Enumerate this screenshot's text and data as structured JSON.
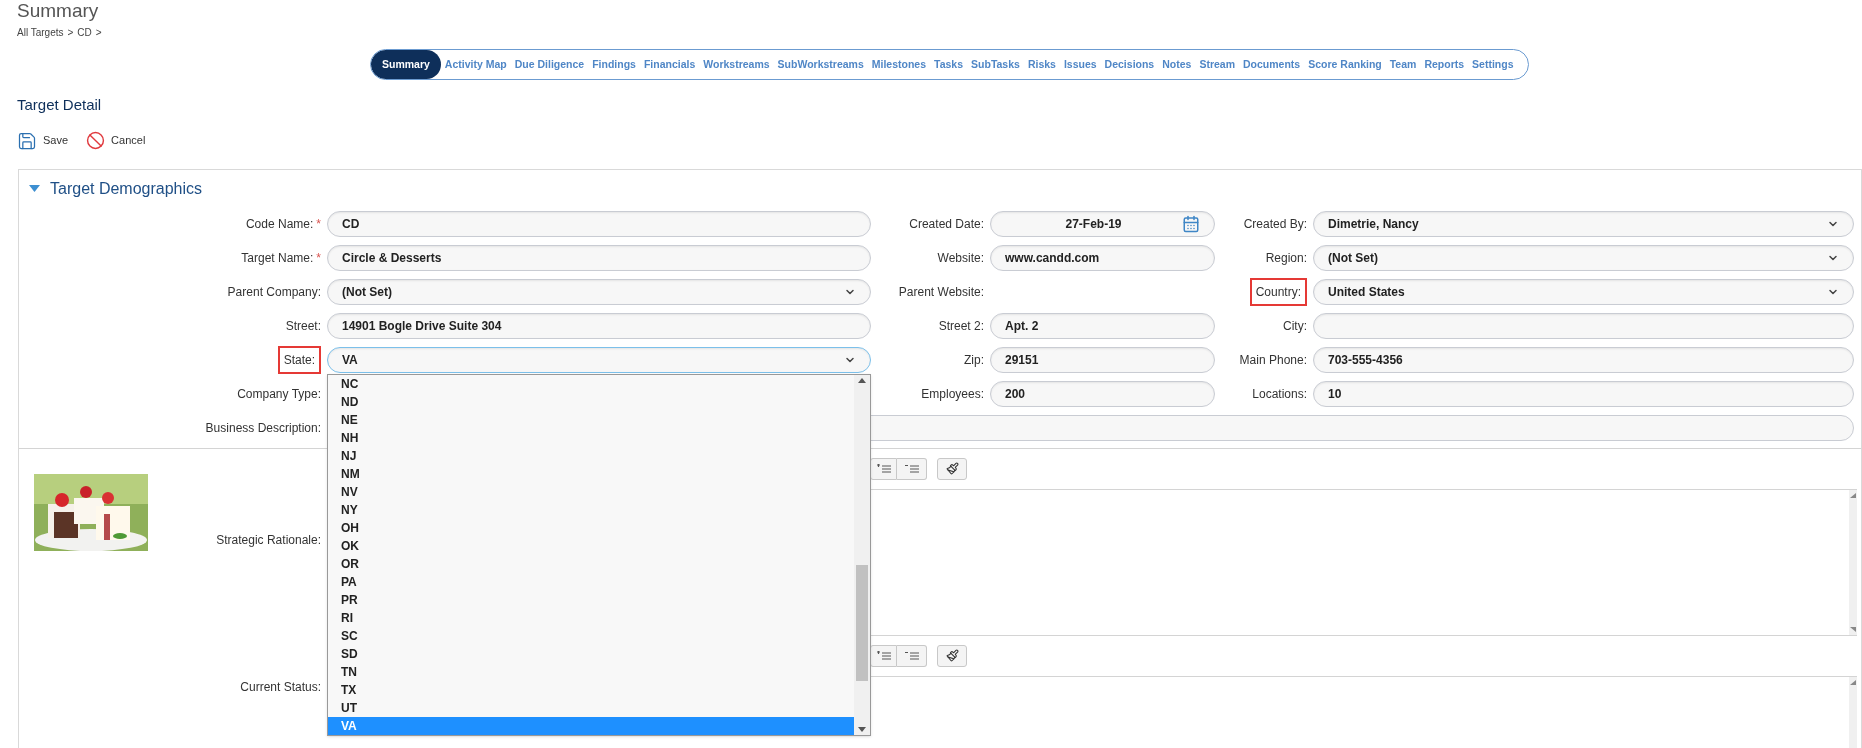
{
  "page": {
    "title": "Summary",
    "breadcrumb": [
      "All Targets",
      ">",
      "CD",
      ">"
    ]
  },
  "tabs": [
    {
      "label": "Summary",
      "selected": true
    },
    {
      "label": "Activity Map",
      "selected": false
    },
    {
      "label": "Due Diligence",
      "selected": false
    },
    {
      "label": "Findings",
      "selected": false
    },
    {
      "label": "Financials",
      "selected": false
    },
    {
      "label": "Workstreams",
      "selected": false
    },
    {
      "label": "SubWorkstreams",
      "selected": false
    },
    {
      "label": "Milestones",
      "selected": false
    },
    {
      "label": "Tasks",
      "selected": false
    },
    {
      "label": "SubTasks",
      "selected": false
    },
    {
      "label": "Risks",
      "selected": false
    },
    {
      "label": "Issues",
      "selected": false
    },
    {
      "label": "Decisions",
      "selected": false
    },
    {
      "label": "Notes",
      "selected": false
    },
    {
      "label": "Stream",
      "selected": false
    },
    {
      "label": "Documents",
      "selected": false
    },
    {
      "label": "Score Ranking",
      "selected": false
    },
    {
      "label": "Team",
      "selected": false
    },
    {
      "label": "Reports",
      "selected": false
    },
    {
      "label": "Settings",
      "selected": false
    }
  ],
  "section_title": "Target Detail",
  "toolbar": [
    {
      "kind": "save",
      "label": "Save"
    },
    {
      "kind": "cancel",
      "label": "Cancel"
    }
  ],
  "panel": {
    "title": "Target Demographics",
    "expanded": true,
    "rows": [
      [
        {
          "label": "Code Name:",
          "required_mark": "*",
          "kind": "text",
          "value": "CD"
        },
        {
          "label": "Created Date:",
          "kind": "date",
          "value": "27-Feb-19"
        },
        {
          "label": "Created By:",
          "kind": "select",
          "value": "Dimetrie, Nancy"
        }
      ],
      [
        {
          "label": "Target Name:",
          "required_mark": "*",
          "kind": "text",
          "value": "Circle & Desserts"
        },
        {
          "label": "Website:",
          "kind": "text",
          "value": "www.candd.com"
        },
        {
          "label": "Region:",
          "kind": "select",
          "value": "(Not Set)"
        }
      ],
      [
        {
          "label": "Parent Company:",
          "kind": "select",
          "value": "(Not Set)"
        },
        {
          "label": "Parent Website:",
          "kind": "static"
        },
        {
          "label": "Country:",
          "kind": "select",
          "value": "United States",
          "highlighted": true
        }
      ],
      [
        {
          "label": "Street:",
          "kind": "text",
          "value": "14901 Bogle Drive Suite 304"
        },
        {
          "label": "Street 2:",
          "kind": "text",
          "value": "Apt. 2"
        },
        {
          "label": "City:",
          "kind": "text"
        }
      ],
      [
        {
          "label": "State:",
          "kind": "select",
          "value": "VA",
          "highlighted": true,
          "open": true
        },
        {
          "label": "Zip:",
          "kind": "text",
          "value": "29151"
        },
        {
          "label": "Main Phone:",
          "kind": "text",
          "value": "703-555-4356"
        }
      ],
      [
        {
          "label": "Company Type:",
          "kind": "static"
        },
        {
          "label": "Employees:",
          "kind": "text",
          "value": "200"
        },
        {
          "label": "Locations:",
          "kind": "text",
          "value": "10"
        }
      ]
    ],
    "business_description": {
      "label": "Business Description:"
    },
    "editors": [
      {
        "label": "Strategic Rationale:"
      },
      {
        "label": "Current Status:"
      }
    ]
  },
  "state_options": [
    {
      "label": "NC",
      "selected": false
    },
    {
      "label": "ND",
      "selected": false
    },
    {
      "label": "NE",
      "selected": false
    },
    {
      "label": "NH",
      "selected": false
    },
    {
      "label": "NJ",
      "selected": false
    },
    {
      "label": "NM",
      "selected": false
    },
    {
      "label": "NV",
      "selected": false
    },
    {
      "label": "NY",
      "selected": false
    },
    {
      "label": "OH",
      "selected": false
    },
    {
      "label": "OK",
      "selected": false
    },
    {
      "label": "OR",
      "selected": false
    },
    {
      "label": "PA",
      "selected": false
    },
    {
      "label": "PR",
      "selected": false
    },
    {
      "label": "RI",
      "selected": false
    },
    {
      "label": "SC",
      "selected": false
    },
    {
      "label": "SD",
      "selected": false
    },
    {
      "label": "TN",
      "selected": false
    },
    {
      "label": "TX",
      "selected": false
    },
    {
      "label": "UT",
      "selected": false
    },
    {
      "label": "VA",
      "selected": true
    }
  ]
}
